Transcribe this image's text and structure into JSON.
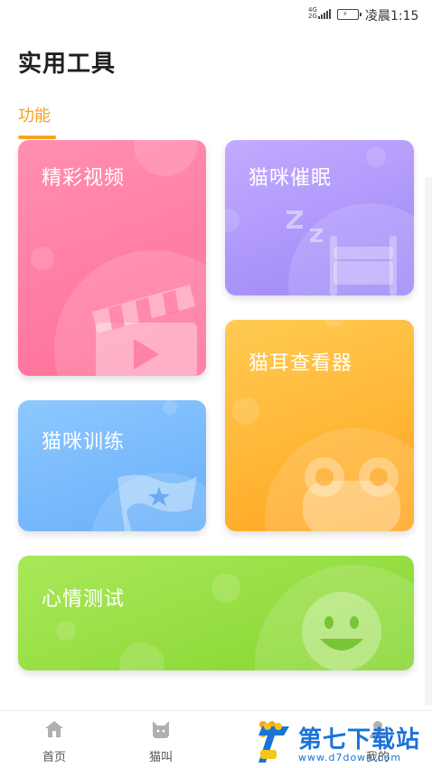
{
  "status_bar": {
    "network_top": "4G",
    "network_bottom": "2G",
    "battery_glyph": "⚡",
    "time": "凌晨1:15"
  },
  "header": {
    "title": "实用工具"
  },
  "tabs": [
    {
      "label": "功能",
      "active": true
    }
  ],
  "cards": {
    "video": {
      "label": "精彩视频",
      "icon": "clapperboard-icon",
      "color": "#ff7aa0"
    },
    "sleep": {
      "label": "猫咪催眠",
      "icon": "bed-sleep-icon",
      "color": "#a792fa"
    },
    "ear": {
      "label": "猫耳查看器",
      "icon": "frog-face-icon",
      "color": "#ffb536"
    },
    "train": {
      "label": "猫咪训练",
      "icon": "star-flag-icon",
      "color": "#78b8fb"
    },
    "mood": {
      "label": "心情测试",
      "icon": "smiley-face-icon",
      "color": "#97df43"
    }
  },
  "bottom_nav": [
    {
      "label": "首页",
      "icon": "home-icon"
    },
    {
      "label": "猫叫",
      "icon": "cat-head-icon"
    },
    {
      "label": "",
      "icon": "tools-icon"
    },
    {
      "label": "我的",
      "icon": "user-icon"
    }
  ],
  "watermark": {
    "title": "第七下载站",
    "url": "www.d7down.com"
  }
}
